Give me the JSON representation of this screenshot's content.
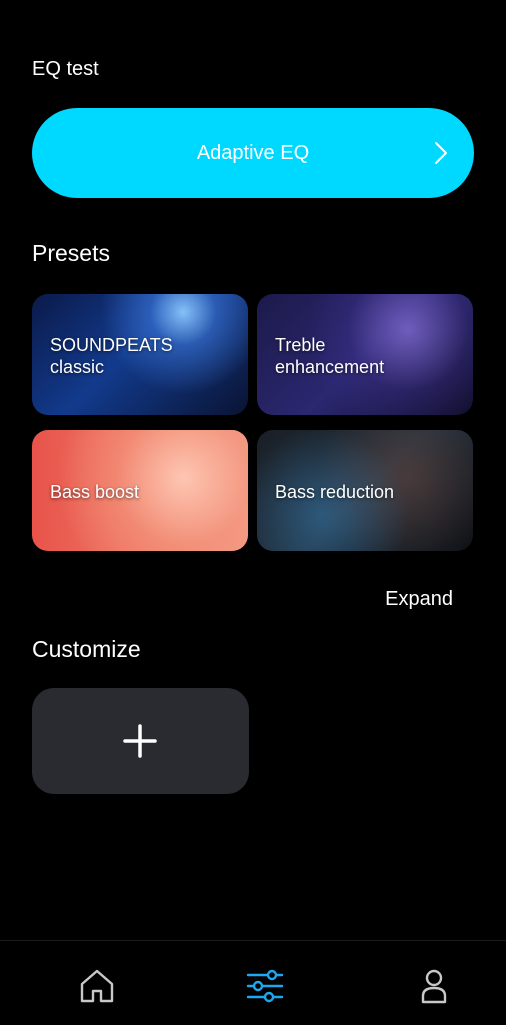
{
  "eq_test": {
    "label": "EQ test",
    "adaptive_button": {
      "label": "Adaptive EQ",
      "icon": "chevron-right-icon",
      "color": "#00d9ff"
    }
  },
  "presets": {
    "heading": "Presets",
    "items": [
      {
        "label": "SOUNDPEATS\nclassic"
      },
      {
        "label": "Treble\nenhancement"
      },
      {
        "label": "Bass boost"
      },
      {
        "label": "Bass reduction"
      }
    ],
    "expand_label": "Expand"
  },
  "customize": {
    "heading": "Customize",
    "add_icon": "plus-icon"
  },
  "bottom_nav": {
    "items": [
      {
        "icon": "home-icon",
        "active": false
      },
      {
        "icon": "equalizer-sliders-icon",
        "active": true
      },
      {
        "icon": "profile-icon",
        "active": false
      }
    ],
    "active_color": "#1ea7f0",
    "inactive_color": "#c8c8c8"
  }
}
